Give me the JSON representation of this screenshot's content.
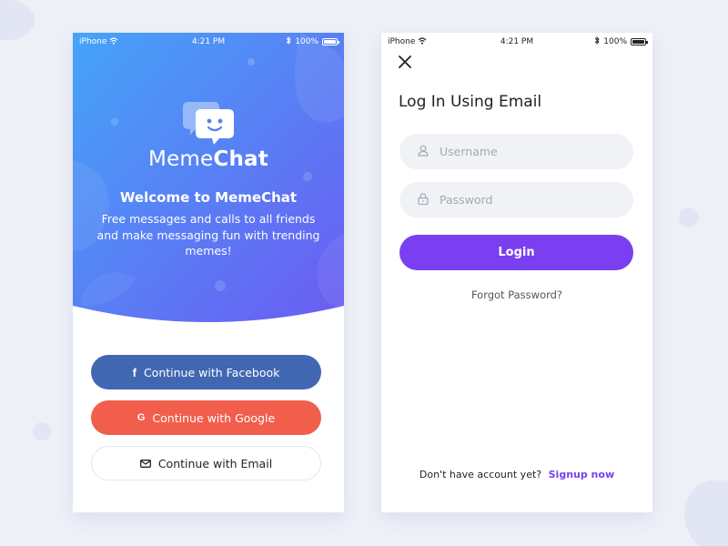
{
  "colors": {
    "page_bg": "#eef0f8",
    "gradient_start": "#4aa6f8",
    "gradient_end": "#6a5cf0",
    "facebook": "#4267b2",
    "google": "#f15e4c",
    "accent_purple": "#7a3ff0",
    "field_bg": "#f1f2f6"
  },
  "status_bar": {
    "carrier": "iPhone",
    "time": "4:21 PM",
    "battery": "100%"
  },
  "welcome_screen": {
    "brand_part1": "Meme",
    "brand_part2": "Chat",
    "title": "Welcome to MemeChat",
    "subtitle": "Free messages and calls to all friends and make messaging fun with trending memes!",
    "facebook_button": "Continue with Facebook",
    "google_button": "Continue with Google",
    "email_button": "Continue with Email",
    "icons": {
      "logo": "chat-bubble-face-icon",
      "facebook": "facebook-icon",
      "google": "google-icon",
      "email": "envelope-icon"
    }
  },
  "login_screen": {
    "title": "Log In Using Email",
    "username_placeholder": "Username",
    "password_placeholder": "Password",
    "login_button": "Login",
    "forgot_password": "Forgot Password?",
    "no_account_text": "Don't have account yet?",
    "signup_link": "Signup now",
    "icons": {
      "close": "close-icon",
      "user": "user-icon",
      "lock": "lock-icon"
    }
  }
}
